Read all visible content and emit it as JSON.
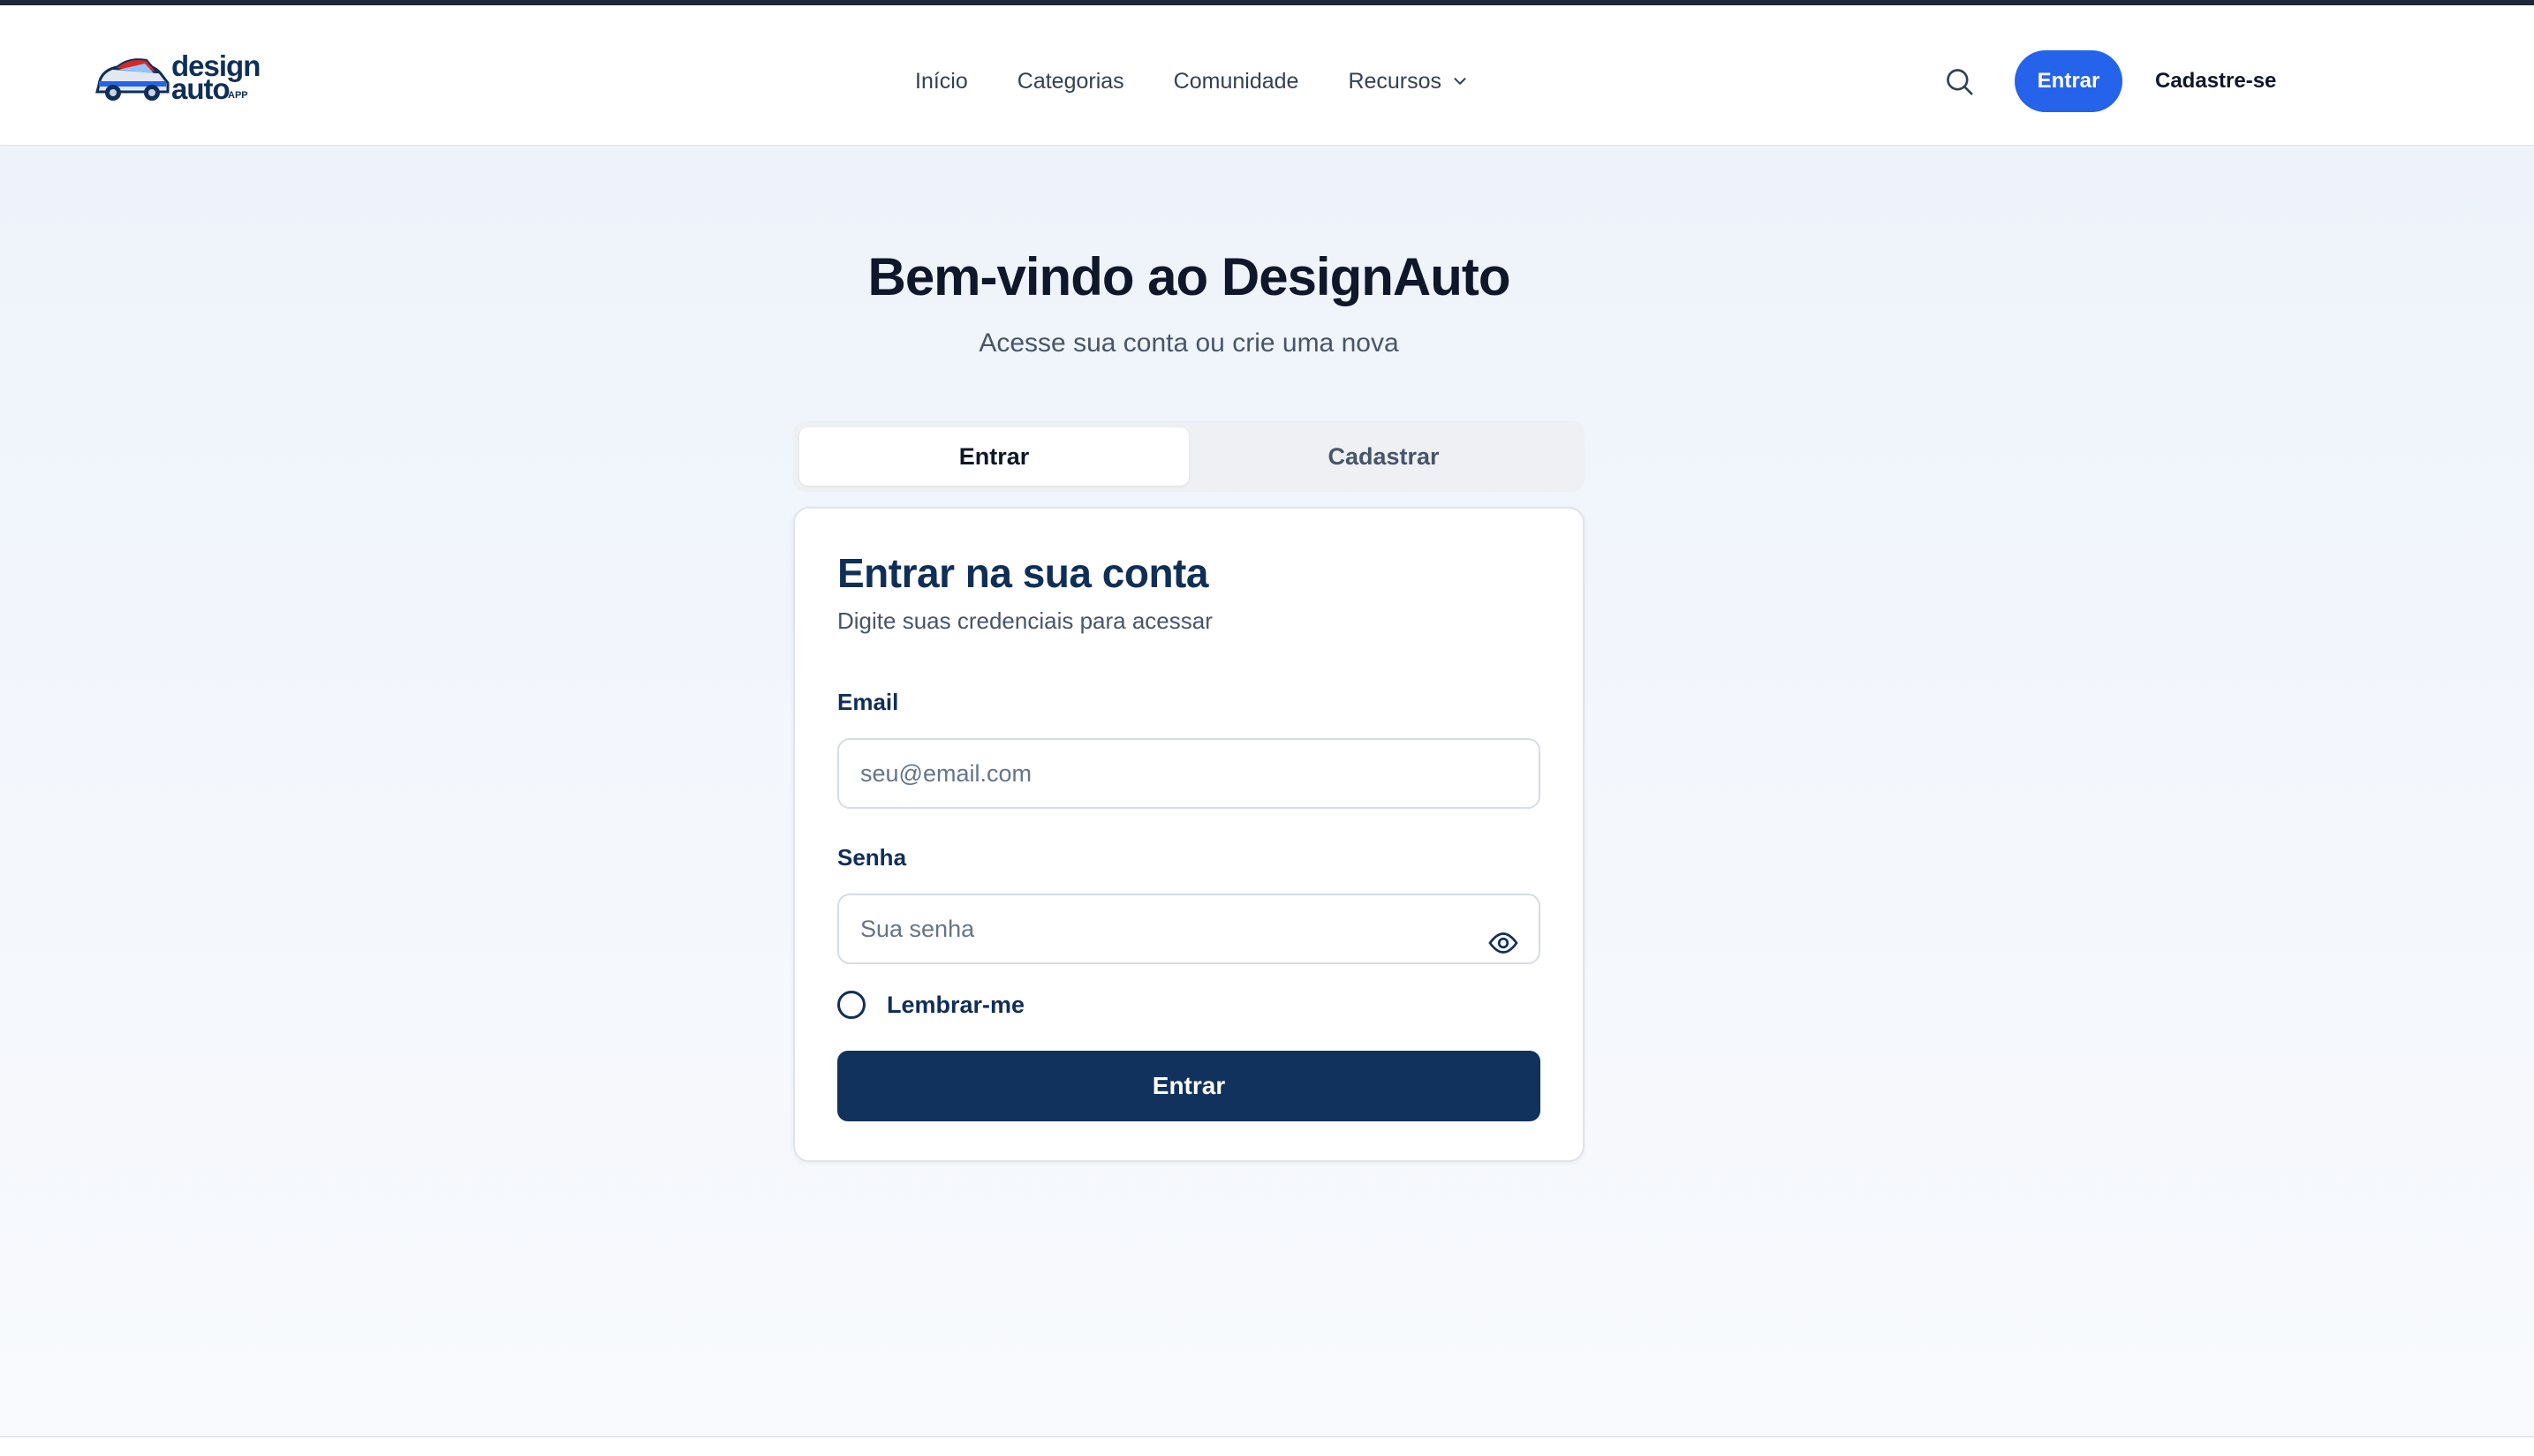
{
  "brand": {
    "logo_word_1": "design",
    "logo_word_2": "auto",
    "logo_word_3": "APP",
    "primary_color": "#2563eb",
    "navy_color": "#10325c"
  },
  "nav": {
    "items": [
      {
        "label": "Início"
      },
      {
        "label": "Categorias"
      },
      {
        "label": "Comunidade"
      },
      {
        "label": "Recursos",
        "icon": "chevron-down-icon"
      }
    ]
  },
  "header_actions": {
    "search_icon": "search-icon",
    "login_label": "Entrar",
    "signup_label": "Cadastre-se"
  },
  "hero": {
    "title": "Bem-vindo ao DesignAuto",
    "subtitle": "Acesse sua conta ou crie uma nova"
  },
  "tabs": [
    {
      "label": "Entrar",
      "active": true
    },
    {
      "label": "Cadastrar",
      "active": false
    }
  ],
  "login_form": {
    "title": "Entrar na sua conta",
    "subtitle": "Digite suas credenciais para acessar",
    "email": {
      "label": "Email",
      "placeholder": "seu@email.com",
      "value": ""
    },
    "password": {
      "label": "Senha",
      "placeholder": "Sua senha",
      "value": "",
      "toggle_icon": "eye-icon"
    },
    "remember_me": {
      "label": "Lembrar-me",
      "checked": false
    },
    "submit_label": "Entrar"
  }
}
